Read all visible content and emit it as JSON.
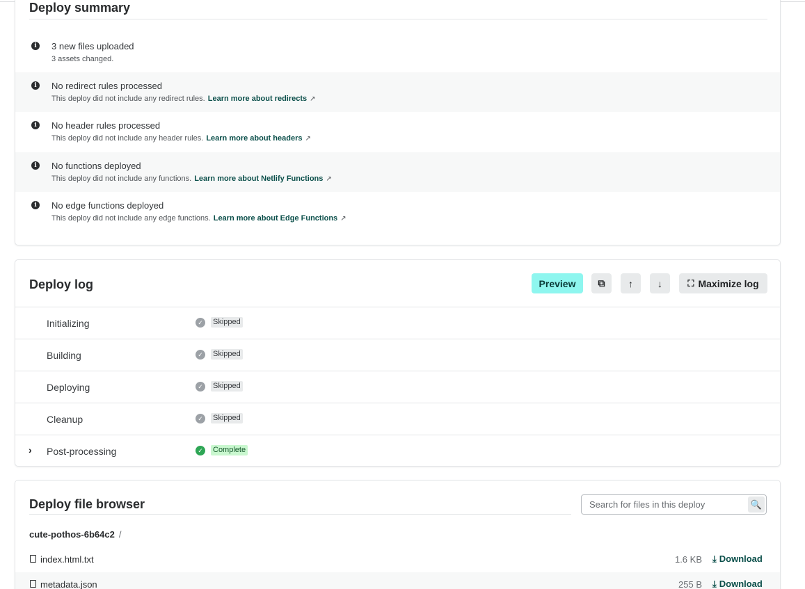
{
  "summary": {
    "title": "Deploy summary",
    "items": [
      {
        "title": "3 new files uploaded",
        "sub": "3 assets changed.",
        "link": ""
      },
      {
        "title": "No redirect rules processed",
        "sub": "This deploy did not include any redirect rules.",
        "link": "Learn more about redirects"
      },
      {
        "title": "No header rules processed",
        "sub": "This deploy did not include any header rules.",
        "link": "Learn more about headers"
      },
      {
        "title": "No functions deployed",
        "sub": "This deploy did not include any functions.",
        "link": "Learn more about Netlify Functions"
      },
      {
        "title": "No edge functions deployed",
        "sub": "This deploy did not include any edge functions.",
        "link": "Learn more about Edge Functions"
      }
    ],
    "ext_glyph": "↗",
    "info_glyph": "i"
  },
  "log": {
    "title": "Deploy log",
    "preview_label": "Preview",
    "maximize_label": "Maximize log",
    "icons": {
      "copy": "⧉",
      "up": "↑",
      "down": "↓",
      "maximize": "⛶"
    },
    "steps": [
      {
        "name": "Initializing",
        "status": "Skipped"
      },
      {
        "name": "Building",
        "status": "Skipped"
      },
      {
        "name": "Deploying",
        "status": "Skipped"
      },
      {
        "name": "Cleanup",
        "status": "Skipped"
      },
      {
        "name": "Post-processing",
        "status": "Complete"
      }
    ]
  },
  "files": {
    "title": "Deploy file browser",
    "search_placeholder": "Search for files in this deploy",
    "search_icon": "🔍",
    "breadcrumb_root": "cute-pothos-6b64c2",
    "breadcrumb_sep": "/",
    "download_label": "Download",
    "download_icon": "⤓",
    "list": [
      {
        "name": "index.html.txt",
        "size": "1.6 KB"
      },
      {
        "name": "metadata.json",
        "size": "255 B"
      }
    ]
  }
}
